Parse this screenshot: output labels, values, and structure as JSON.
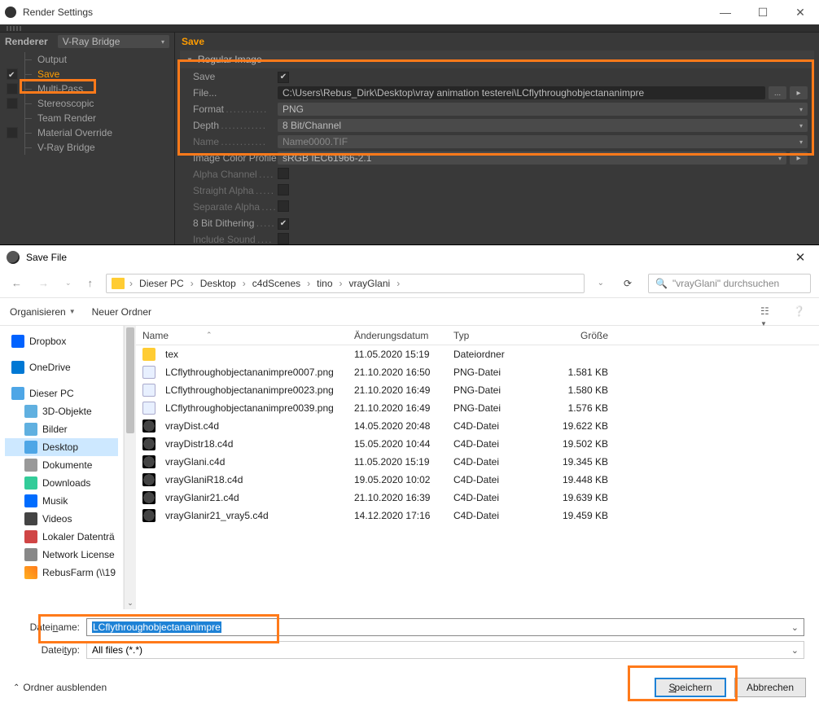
{
  "render_settings": {
    "title": "Render Settings",
    "renderer_label": "Renderer",
    "renderer_value": "V-Ray Bridge",
    "tree": [
      {
        "label": "Output",
        "check": false,
        "has_check": false
      },
      {
        "label": "Save",
        "check": true,
        "has_check": true,
        "selected": true
      },
      {
        "label": "Multi-Pass",
        "check": false,
        "has_check": true
      },
      {
        "label": "Stereoscopic",
        "check": false,
        "has_check": true
      },
      {
        "label": "Team Render",
        "check": false,
        "has_check": false
      },
      {
        "label": "Material Override",
        "check": false,
        "has_check": true
      },
      {
        "label": "V-Ray Bridge",
        "check": false,
        "has_check": false
      }
    ],
    "right_header": "Save",
    "panel_title": "Regular Image",
    "fields": {
      "save_label": "Save",
      "save_on": true,
      "file_label": "File...",
      "file_path": "C:\\Users\\Rebus_Dirk\\Desktop\\vray animation testerei\\LCflythroughobjectananimpre",
      "format_label": "Format",
      "format_value": "PNG",
      "depth_label": "Depth",
      "depth_value": "8 Bit/Channel",
      "name_label": "Name",
      "name_value": "Name0000.TIF",
      "icp_label": "Image Color Profile",
      "icp_value": "sRGB IEC61966-2.1",
      "alpha_label": "Alpha Channel",
      "alpha_on": false,
      "straight_label": "Straight Alpha",
      "straight_on": false,
      "separate_label": "Separate Alpha",
      "separate_on": false,
      "dither_label": "8 Bit Dithering",
      "dither_on": true,
      "sound_label": "Include Sound",
      "sound_on": false
    }
  },
  "save_file": {
    "title": "Save File",
    "crumb_items": [
      "Dieser PC",
      "Desktop",
      "c4dScenes",
      "tino",
      "vrayGlani"
    ],
    "search_placeholder": "\"vrayGlani\" durchsuchen",
    "toolbar": {
      "organize": "Organisieren",
      "new_folder": "Neuer Ordner"
    },
    "tree": [
      {
        "label": "Dropbox",
        "icon": "ic-dropbox"
      },
      {
        "label": "OneDrive",
        "icon": "ic-onedrive"
      },
      {
        "label": "Dieser PC",
        "icon": "ic-pc"
      },
      {
        "label": "3D-Objekte",
        "icon": "ic-3d",
        "indent": true
      },
      {
        "label": "Bilder",
        "icon": "ic-pic",
        "indent": true
      },
      {
        "label": "Desktop",
        "icon": "ic-desk",
        "indent": true,
        "selected": true
      },
      {
        "label": "Dokumente",
        "icon": "ic-doc",
        "indent": true
      },
      {
        "label": "Downloads",
        "icon": "ic-dl",
        "indent": true
      },
      {
        "label": "Musik",
        "icon": "ic-music",
        "indent": true
      },
      {
        "label": "Videos",
        "icon": "ic-video",
        "indent": true
      },
      {
        "label": "Lokaler Datenträ",
        "icon": "ic-drive",
        "indent": true
      },
      {
        "label": "Network License",
        "icon": "ic-net",
        "indent": true
      },
      {
        "label": "RebusFarm (\\\\19",
        "icon": "ic-rebus",
        "indent": true
      }
    ],
    "columns": {
      "name": "Name",
      "date": "Änderungsdatum",
      "type": "Typ",
      "size": "Größe"
    },
    "rows": [
      {
        "name": "tex",
        "date": "11.05.2020 15:19",
        "type": "Dateiordner",
        "size": "",
        "icon": "fico-folder"
      },
      {
        "name": "LCflythroughobjectananimpre0007.png",
        "date": "21.10.2020 16:50",
        "type": "PNG-Datei",
        "size": "1.581 KB",
        "icon": "fico-png"
      },
      {
        "name": "LCflythroughobjectananimpre0023.png",
        "date": "21.10.2020 16:49",
        "type": "PNG-Datei",
        "size": "1.580 KB",
        "icon": "fico-png"
      },
      {
        "name": "LCflythroughobjectananimpre0039.png",
        "date": "21.10.2020 16:49",
        "type": "PNG-Datei",
        "size": "1.576 KB",
        "icon": "fico-png"
      },
      {
        "name": "vrayDist.c4d",
        "date": "14.05.2020 20:48",
        "type": "C4D-Datei",
        "size": "19.622 KB",
        "icon": "fico-c4d"
      },
      {
        "name": "vrayDistr18.c4d",
        "date": "15.05.2020 10:44",
        "type": "C4D-Datei",
        "size": "19.502 KB",
        "icon": "fico-c4d"
      },
      {
        "name": "vrayGlani.c4d",
        "date": "11.05.2020 15:19",
        "type": "C4D-Datei",
        "size": "19.345 KB",
        "icon": "fico-c4d"
      },
      {
        "name": "vrayGlaniR18.c4d",
        "date": "19.05.2020 10:02",
        "type": "C4D-Datei",
        "size": "19.448 KB",
        "icon": "fico-c4d"
      },
      {
        "name": "vrayGlanir21.c4d",
        "date": "21.10.2020 16:39",
        "type": "C4D-Datei",
        "size": "19.639 KB",
        "icon": "fico-c4d"
      },
      {
        "name": "vrayGlanir21_vray5.c4d",
        "date": "14.12.2020 17:16",
        "type": "C4D-Datei",
        "size": "19.459 KB",
        "icon": "fico-c4d"
      }
    ],
    "filename_label": "Dateiname:",
    "filename_value": "LCflythroughobjectananimpre",
    "filetype_label": "Dateityp:",
    "filetype_value": "All files (*.*)",
    "hide_folders": "Ordner ausblenden",
    "save_btn": "Speichern",
    "cancel_btn": "Abbrechen"
  }
}
